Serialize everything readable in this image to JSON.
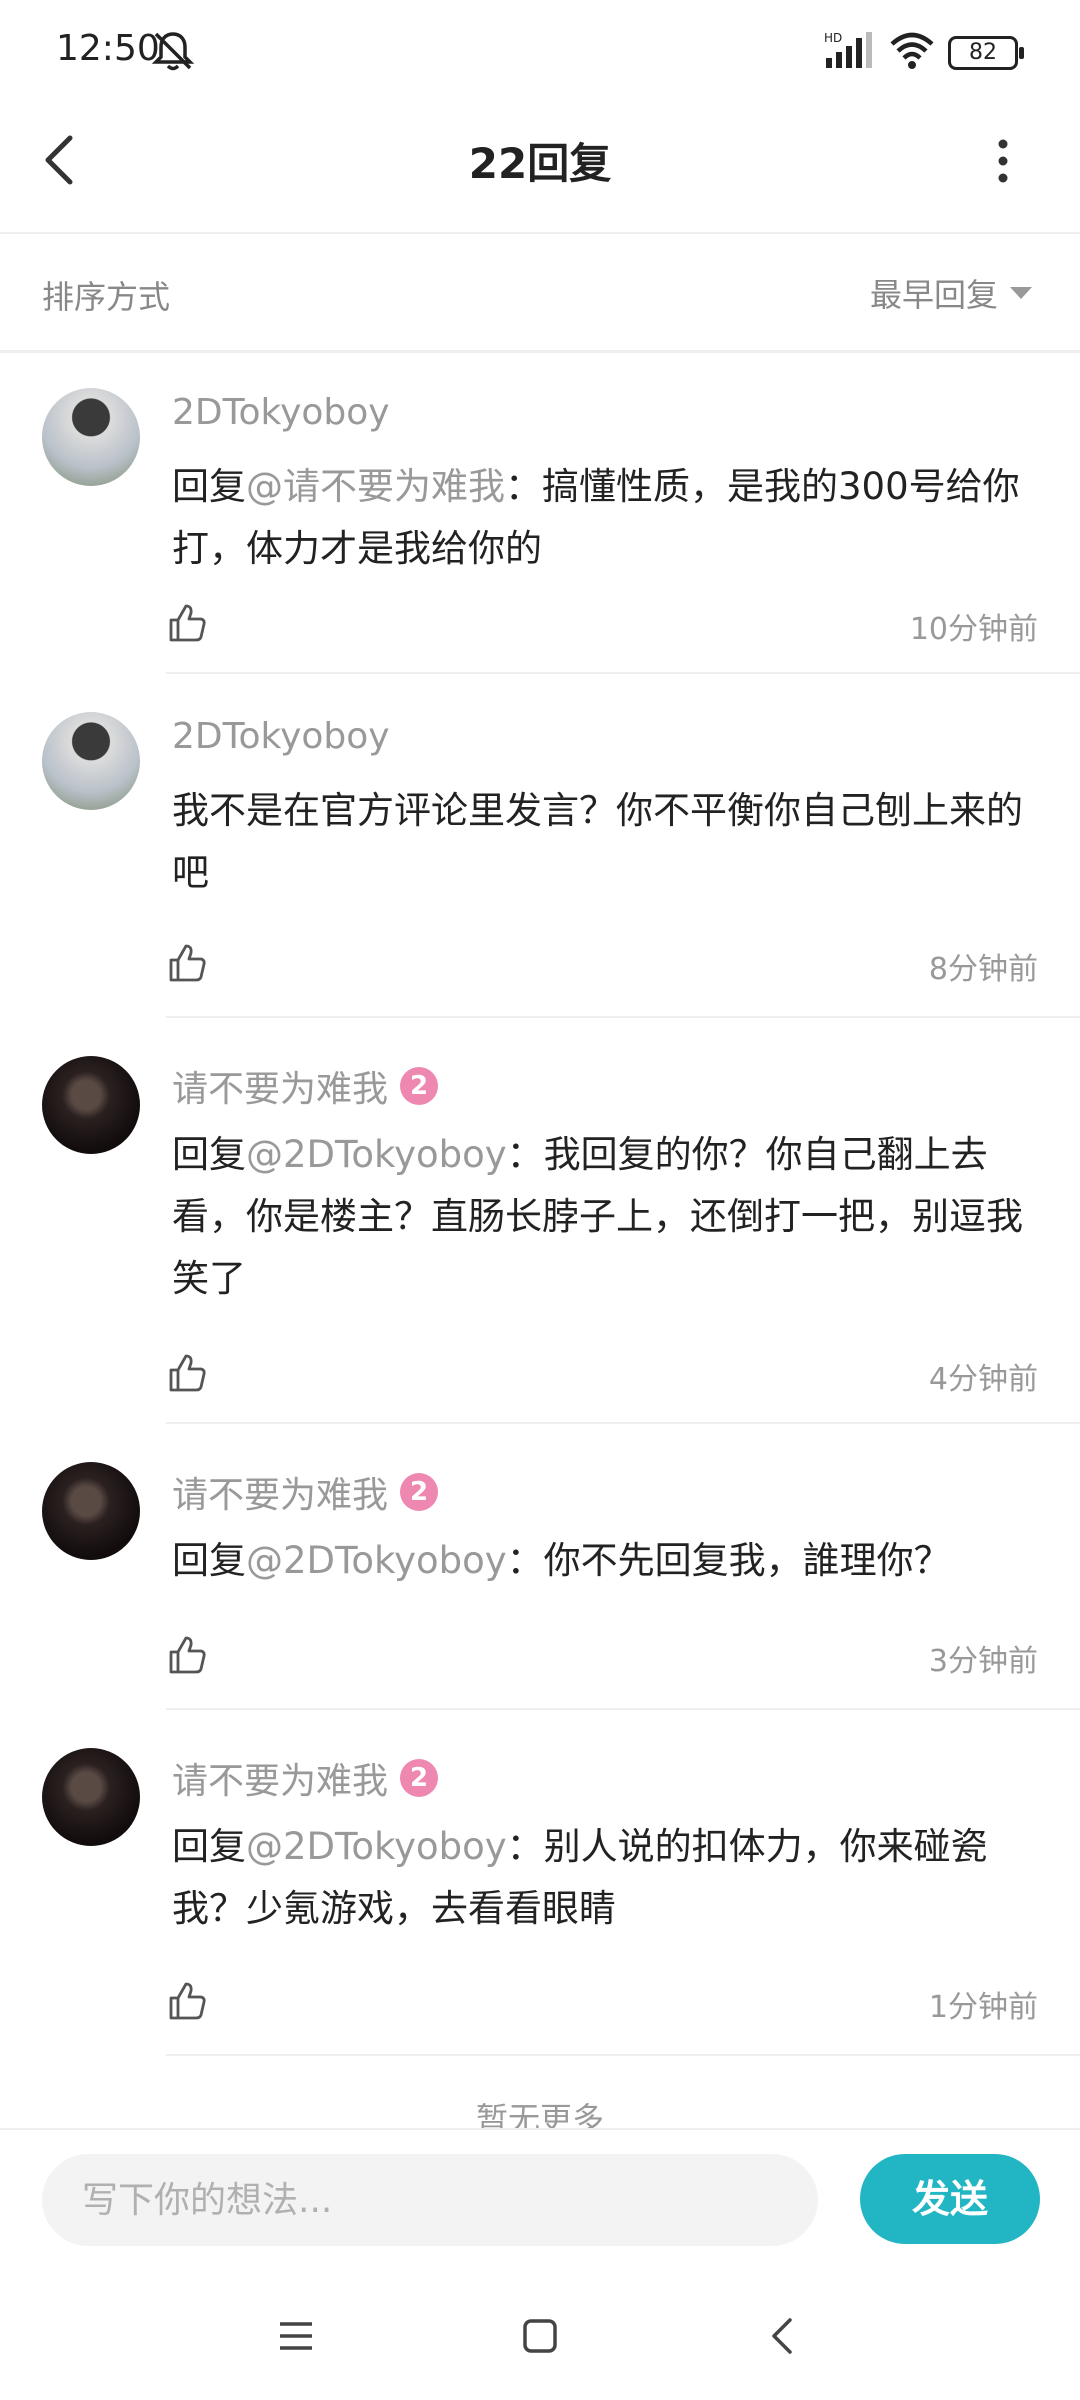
{
  "status_bar": {
    "time": "12:50",
    "battery": "82",
    "network": "HD"
  },
  "header": {
    "title": "22回复"
  },
  "sort": {
    "label": "排序方式",
    "selected": "最早回复"
  },
  "comments": [
    {
      "user": "2DTokyoboy",
      "badge": "",
      "prefix": "回复",
      "mention": "@请不要为难我",
      "body": "：搞懂性质，是我的300号给你打，体力才是我给你的",
      "time": "10分钟前"
    },
    {
      "user": "2DTokyoboy",
      "badge": "",
      "prefix": "",
      "mention": "",
      "body": "我不是在官方评论里发言？你不平衡你自己刨上来的吧",
      "time": "8分钟前"
    },
    {
      "user": "请不要为难我",
      "badge": "2",
      "prefix": "回复",
      "mention": "@2DTokyoboy",
      "body": "：我回复的你？你自己翻上去看，你是楼主？直肠长脖子上，还倒打一把，别逗我笑了",
      "time": "4分钟前"
    },
    {
      "user": "请不要为难我",
      "badge": "2",
      "prefix": "回复",
      "mention": "@2DTokyoboy",
      "body": "：你不先回复我，誰理你？",
      "time": "3分钟前"
    },
    {
      "user": "请不要为难我",
      "badge": "2",
      "prefix": "回复",
      "mention": "@2DTokyoboy",
      "body": "：别人说的扣体力，你来碰瓷我？少氪游戏，去看看眼睛",
      "time": "1分钟前"
    }
  ],
  "footer": {
    "no_more": "暂无更多"
  },
  "composer": {
    "placeholder": "写下你的想法...",
    "send_label": "发送"
  },
  "colors": {
    "accent": "#22b5c4",
    "badge": "#ee88b0",
    "muted": "#999999"
  }
}
